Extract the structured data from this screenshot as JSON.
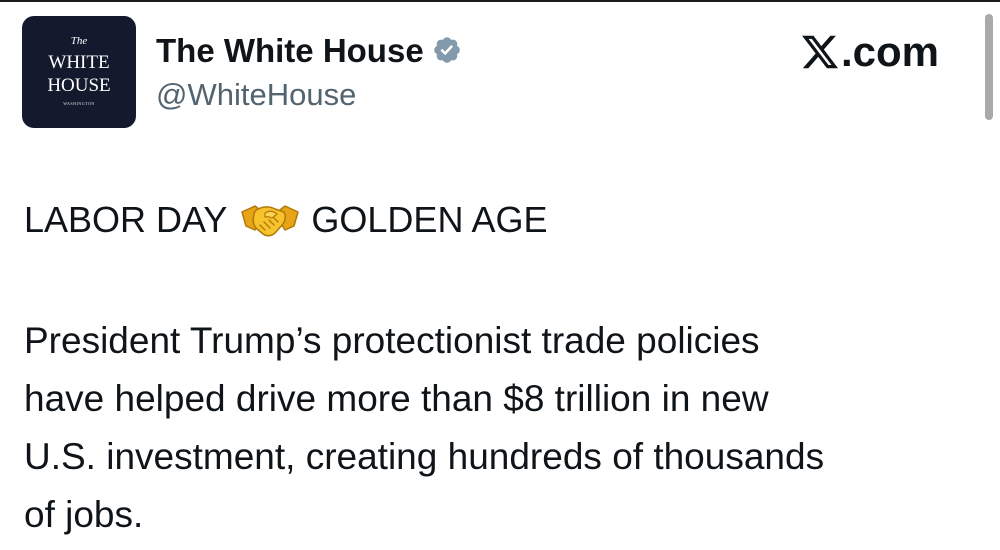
{
  "account": {
    "avatar_line1": "The",
    "avatar_line2": "WHITE",
    "avatar_line3": "HOUSE",
    "avatar_line4": "WASHINGTON",
    "display_name": "The White House",
    "handle": "@WhiteHouse",
    "verified_icon": "verified-badge-icon"
  },
  "brand": {
    "site_label": ".com",
    "logo_icon": "x-logo-icon"
  },
  "post": {
    "headline_left": "LABOR DAY",
    "headline_emoji": "handshake-icon",
    "headline_right": "GOLDEN AGE",
    "body_lines": [
      "President Trump’s protectionist trade policies",
      "have helped drive more than $8 trillion in new",
      "U.S. investment, creating hundreds of thousands",
      "of jobs."
    ]
  },
  "colors": {
    "text": "#0f1419",
    "secondary_text": "#536471",
    "avatar_background": "#141a2e",
    "verified_badge": "#829aab",
    "scrollbar": "#a9a9a9"
  }
}
